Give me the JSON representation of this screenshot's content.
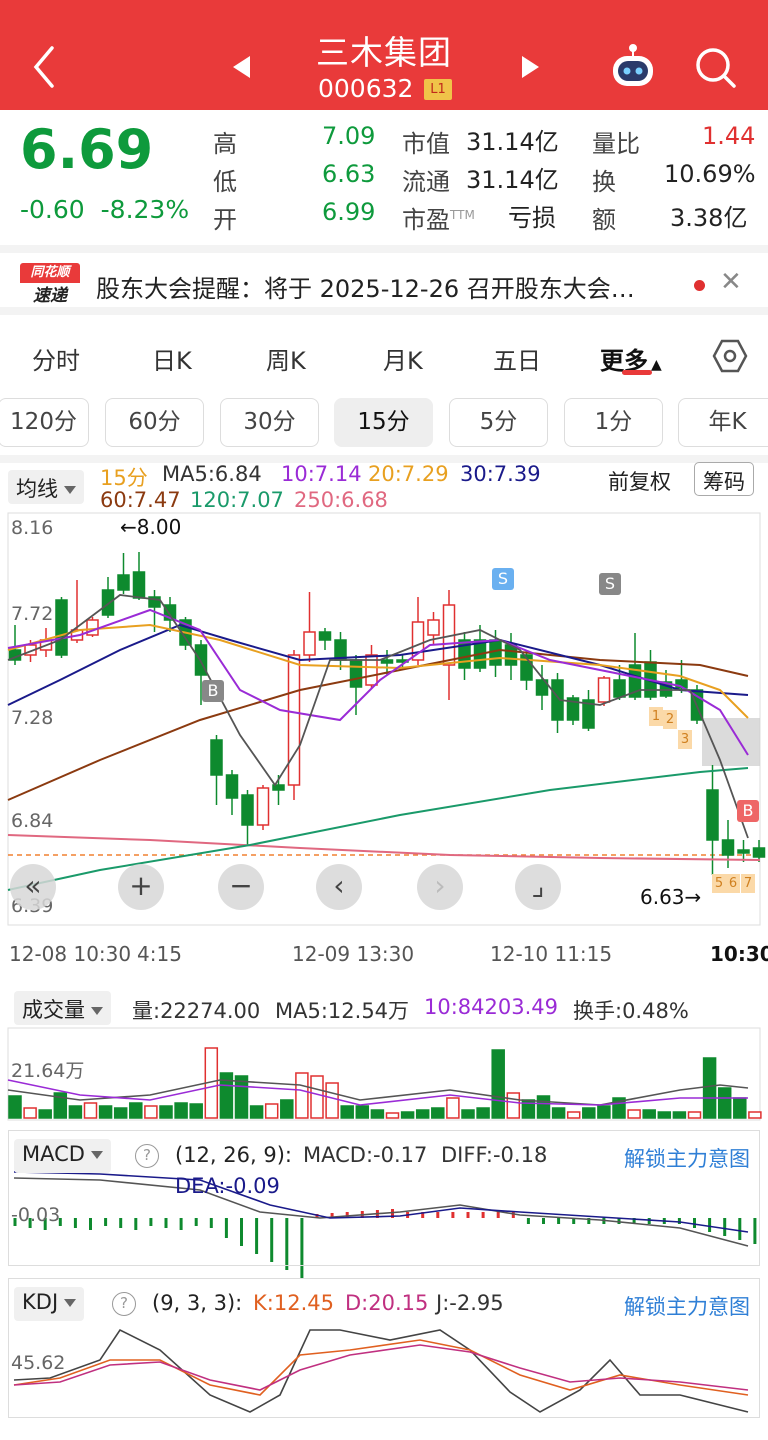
{
  "header": {
    "title": "三木集团",
    "code": "000632",
    "level_badge": "L1",
    "bg_color": "#e93a3a"
  },
  "quote": {
    "price": "6.69",
    "change": "-0.60",
    "change_pct": "-8.23%",
    "high_label": "高",
    "high": "7.09",
    "low_label": "低",
    "low": "6.63",
    "open_label": "开",
    "open": "6.99",
    "mcap_label": "市值",
    "mcap": "31.14亿",
    "float_label": "流通",
    "float": "31.14亿",
    "pe_label": "市盈",
    "pe_sup": "TTM",
    "pe": "亏损",
    "vr_label": "量比",
    "vr": "1.44",
    "turnover_label": "换",
    "turnover": "10.69%",
    "amount_label": "额",
    "amount": "3.38亿"
  },
  "banner": {
    "logo_top": "同花顺",
    "logo_bottom": "速递",
    "text": "股东大会提醒：将于 2025-12-26 召开股东大会…"
  },
  "tabs": [
    "分时",
    "日K",
    "周K",
    "月K",
    "五日",
    "更多"
  ],
  "active_tab": "更多",
  "periods": [
    "120分",
    "60分",
    "30分",
    "15分",
    "5分",
    "1分",
    "年K"
  ],
  "active_period": "15分",
  "main_chart": {
    "indicator_select": "均线",
    "period_label": "15分",
    "ma5": "MA5:6.84",
    "ma10": "10:7.14",
    "ma20": "20:7.29",
    "ma30": "30:7.39",
    "ma60": "60:7.47",
    "ma120": "120:7.07",
    "ma250": "250:6.68",
    "adjust": "前复权",
    "chips": "筹码",
    "y_labels": [
      "8.16",
      "7.72",
      "7.28",
      "6.84",
      "6.39"
    ],
    "high_mark": "←8.00",
    "low_mark": "6.63→",
    "x_labels": [
      "12-08 10:30",
      "4:15",
      "12-09 13:30",
      "12-10 11:15",
      "10:30"
    ],
    "signals": [
      "S",
      "S",
      "B",
      "B"
    ],
    "nine_turn": [
      "1",
      "2",
      "3",
      "1",
      "2",
      "3",
      "5",
      "6",
      "7"
    ],
    "colors": {
      "up": "#e03030",
      "down": "#0e8a2e",
      "ma5": "#555555",
      "ma10": "#9a2bd6",
      "ma20": "#e8a020",
      "ma30": "#1a1a8a",
      "ma60": "#8b3a10",
      "ma120": "#1a9a6a",
      "ma250": "#e06880"
    }
  },
  "controls": [
    "«",
    "+",
    "−",
    "‹",
    "›",
    "⌟"
  ],
  "volume": {
    "select": "成交量",
    "vol": "量:22274.00",
    "ma5": "MA5:12.54万",
    "ma10": "10:84203.49",
    "turnover": "换手:0.48%",
    "y_label": "21.64万"
  },
  "macd": {
    "select": "MACD",
    "params": "(12, 26, 9):",
    "macd": "MACD:-0.17",
    "diff": "DIFF:-0.18",
    "dea": "DEA:-0.09",
    "y_label": "-0.03",
    "unlock": "解锁主力意图"
  },
  "kdj": {
    "select": "KDJ",
    "params": "(9, 3, 3):",
    "k": "K:12.45",
    "d": "D:20.15",
    "j": "J:-2.95",
    "y_label": "45.62",
    "unlock": "解锁主力意图"
  }
}
